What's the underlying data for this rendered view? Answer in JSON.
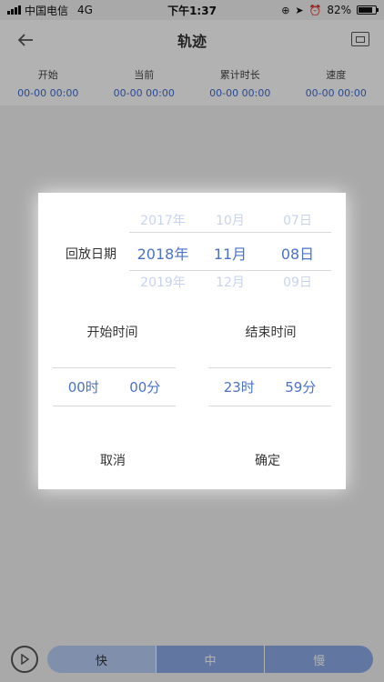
{
  "status_bar": {
    "carrier": "中国电信",
    "network": "4G",
    "time": "下午1:37",
    "battery": "82%",
    "battery_level": 0.82
  },
  "header": {
    "title": "轨迹"
  },
  "stats": [
    {
      "label": "开始",
      "value": "00-00 00:00"
    },
    {
      "label": "当前",
      "value": "00-00 00:00"
    },
    {
      "label": "累计时长",
      "value": "00-00 00:00"
    },
    {
      "label": "速度",
      "value": "00-00 00:00"
    }
  ],
  "bottom": {
    "speed_first": "快",
    "speed_second": "中",
    "speed_third": "慢"
  },
  "dialog": {
    "date_label": "回放日期",
    "prev": {
      "year": "2017年",
      "month": "10月",
      "day": "07日"
    },
    "current": {
      "year": "2018年",
      "month": "11月",
      "day": "08日"
    },
    "next": {
      "year": "2019年",
      "month": "12月",
      "day": "09日"
    },
    "start_title": "开始时间",
    "end_title": "结束时间",
    "start": {
      "hour": "00时",
      "minute": "00分"
    },
    "end": {
      "hour": "23时",
      "minute": "59分"
    },
    "cancel": "取消",
    "confirm": "确定"
  }
}
